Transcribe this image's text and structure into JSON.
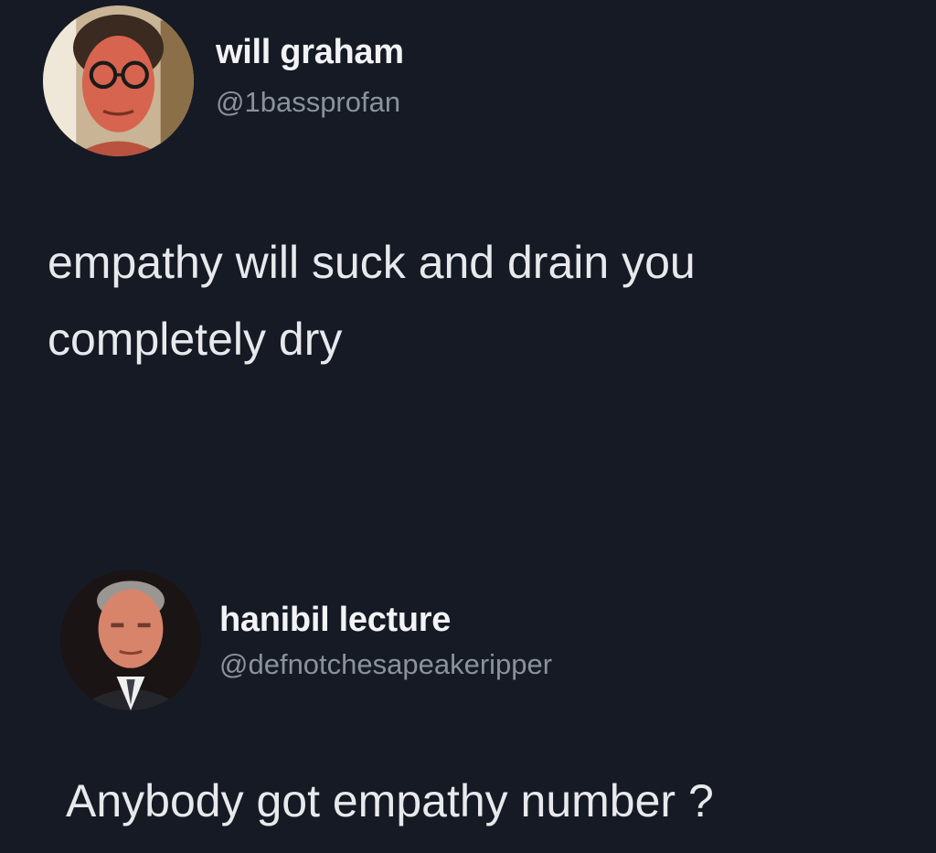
{
  "posts": [
    {
      "author": {
        "display_name": "will graham",
        "handle": "@1bassprofan",
        "avatar_icon": "avatar-man-glasses"
      },
      "text": "empathy will suck and drain you completely dry"
    },
    {
      "author": {
        "display_name": "hanibil lecture",
        "handle": "@defnotchesapeakeripper",
        "avatar_icon": "avatar-man-suit"
      },
      "text": "Anybody got empathy number ?"
    }
  ],
  "colors": {
    "background": "#161a24",
    "text": "#e7e9ec",
    "handle": "#8b929b"
  }
}
